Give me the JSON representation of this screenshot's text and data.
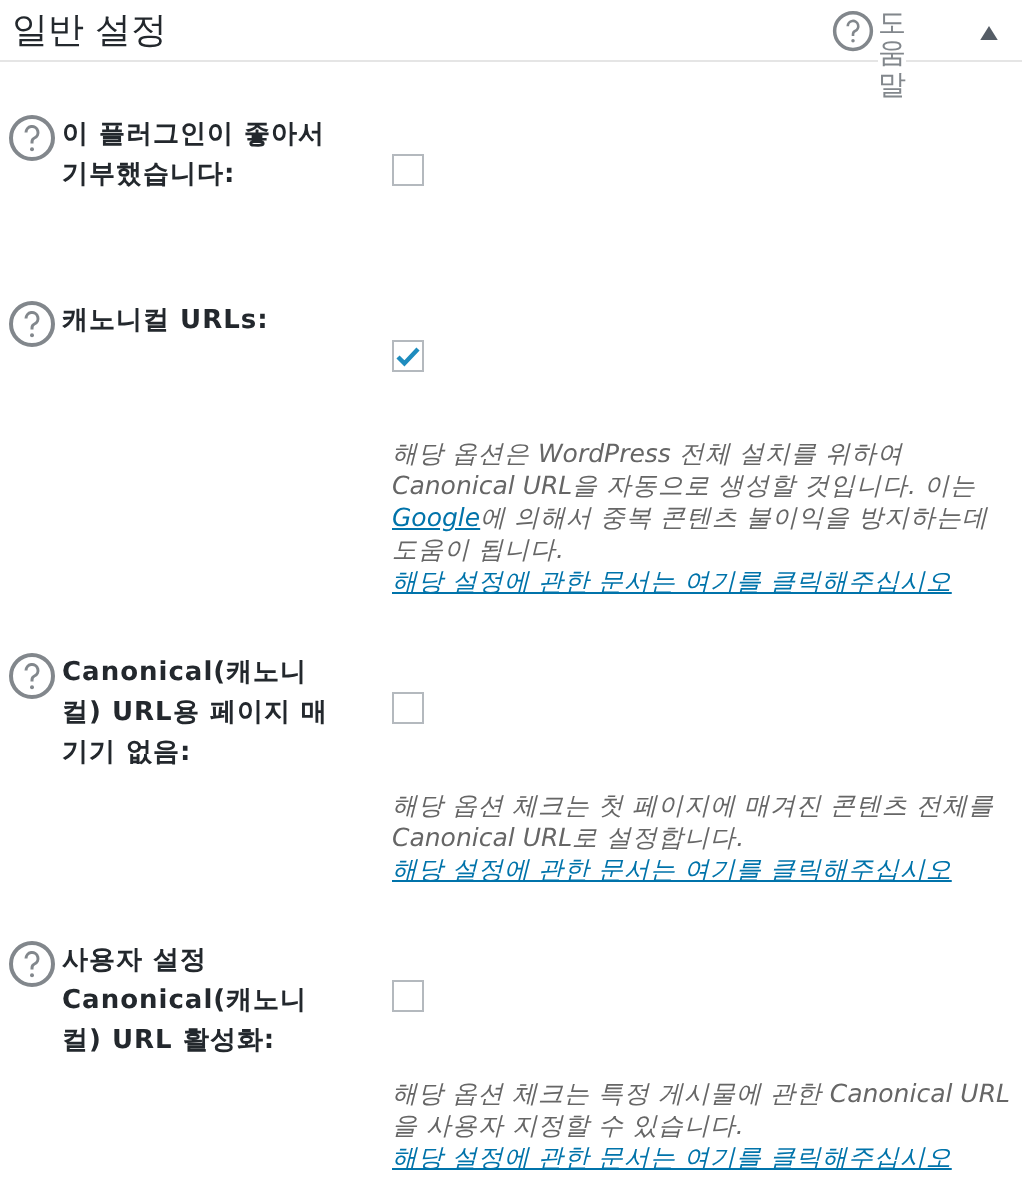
{
  "panel": {
    "title": "일반 설정",
    "help_label": "도움말",
    "expanded": true
  },
  "settings": [
    {
      "label": "이 플러그인이 좋아서 기부했습니다:",
      "checked": false
    },
    {
      "label": "캐노니컬 URLs:",
      "checked": true,
      "description": [
        {
          "kind": "text",
          "text": "해당 옵션은 WordPress 전체 설치를 위하여 Canonical URL을 자동으로 생성할 것입니다. 이는 "
        },
        {
          "kind": "link",
          "text": "Google"
        },
        {
          "kind": "text",
          "text": "에 의해서 중복 콘텐츠 불이익을 방지하는데 도움이 됩니다."
        }
      ],
      "doc_link": "해당 설정에 관한 문서는 여기를 클릭해주십시오"
    },
    {
      "label": "Canonical(캐노니컬) URL용 페이지 매기기 없음:",
      "checked": false,
      "description": [
        {
          "kind": "text",
          "text": "해당 옵션 체크는 첫 페이지에 매겨진 콘텐츠 전체를 Canonical URL로 설정합니다."
        }
      ],
      "doc_link": "해당 설정에 관한 문서는 여기를 클릭해주십시오"
    },
    {
      "label": "사용자 설정 Canonical(캐노니컬) URL 활성화:",
      "checked": false,
      "description": [
        {
          "kind": "text",
          "text": "해당 옵션 체크는 특정 게시물에 관한 Canonical URL을 사용자 지정할 수 있습니다."
        }
      ],
      "doc_link": "해당 설정에 관한 문서는 여기를 클릭해주십시오"
    }
  ]
}
